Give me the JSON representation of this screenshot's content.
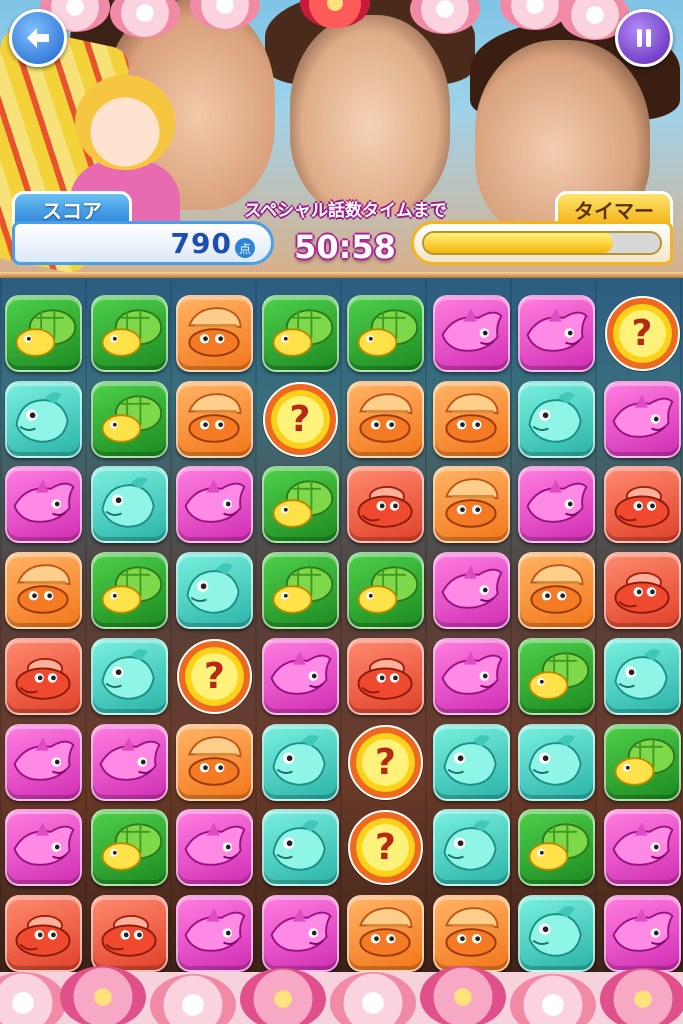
{
  "header": {
    "back_button_icon": "back-arrow-icon",
    "pause_button_icon": "pause-icon"
  },
  "score": {
    "label": "スコア",
    "value": "790",
    "unit": "点"
  },
  "special": {
    "label": "スペシャル話数タイムまで",
    "countdown": "50:58"
  },
  "timer": {
    "label": "タイマー",
    "fill_fraction": 0.8
  },
  "board": {
    "columns": 8,
    "rows": 8,
    "mystery_glyph": "?",
    "grid": [
      [
        "turtle",
        "turtle",
        "shrimp",
        "turtle",
        "turtle",
        "ray",
        "ray",
        "mystery"
      ],
      [
        "fish",
        "turtle",
        "shrimp",
        "mystery",
        "shrimp",
        "shrimp",
        "fish",
        "ray"
      ],
      [
        "ray",
        "fish",
        "ray",
        "turtle",
        "crab",
        "shrimp",
        "ray",
        "crab"
      ],
      [
        "shrimp",
        "turtle",
        "fish",
        "turtle",
        "turtle",
        "ray",
        "shrimp",
        "crab"
      ],
      [
        "crab",
        "fish",
        "mystery",
        "ray",
        "crab",
        "ray",
        "turtle",
        "fish"
      ],
      [
        "ray",
        "ray",
        "shrimp",
        "fish",
        "mystery",
        "fish",
        "fish",
        "turtle"
      ],
      [
        "ray",
        "turtle",
        "ray",
        "fish",
        "mystery",
        "fish",
        "turtle",
        "ray"
      ],
      [
        "crab",
        "crab",
        "ray",
        "ray",
        "shrimp",
        "shrimp",
        "fish",
        "ray"
      ]
    ]
  },
  "colors": {
    "turtle": "#2fae34",
    "fish": "#4fd6c8",
    "shrimp": "#f58a2a",
    "crab": "#ee5a3e",
    "ray": "#e64cc8",
    "mystery": "#ffd21a",
    "score_accent": "#2d84d8",
    "timer_accent": "#f3b51b",
    "countdown_outline": "#b0249a"
  }
}
